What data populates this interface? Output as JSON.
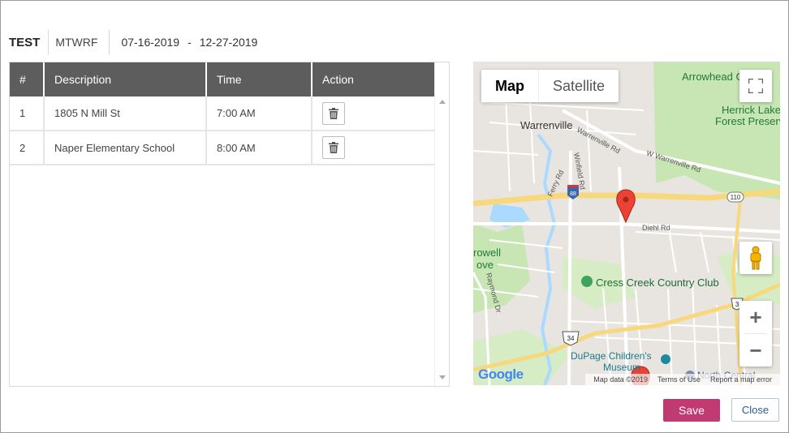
{
  "header": {
    "route_name": "TEST",
    "days": "MTWRF",
    "start_date": "07-16-2019",
    "date_separator": "-",
    "end_date": "12-27-2019"
  },
  "table": {
    "columns": [
      "#",
      "Description",
      "Time",
      "Action"
    ],
    "rows": [
      {
        "num": "1",
        "description": "1805 N Mill St",
        "time": "7:00 AM",
        "action_icon": "trash-icon"
      },
      {
        "num": "2",
        "description": "Naper Elementary School",
        "time": "8:00 AM",
        "action_icon": "trash-icon"
      }
    ]
  },
  "map": {
    "type_buttons": {
      "map": "Map",
      "satellite": "Satellite"
    },
    "selected_type": "Map",
    "labels": {
      "warrenville": "Warrenville",
      "arrowhead": "Arrowhead G",
      "herrick": "Herrick Lake",
      "forest": "Forest Preserv",
      "w_warrenville_rd": "W Warrenville Rd",
      "warrenville_rd": "Warrenville Rd",
      "diehl_rd": "Diehl Rd",
      "ferry_rd": "Ferry Rd",
      "winfield_rd": "Winfield Rd",
      "cress_creek": "Cress Creek Country Club",
      "dupage_childrens": "DuPage Children's",
      "museum": "Museum",
      "north_central": "North Central",
      "rowell": "rowell",
      "ove": "ove",
      "raymond_dr": "Raymond Dr",
      "shield_88": "88",
      "shield_110": "110",
      "shield_34": "34",
      "shield_3": "3"
    },
    "google_logo": "Google",
    "footer": {
      "map_data": "Map data ©2019",
      "terms": "Terms of Use",
      "report": "Report a map error"
    },
    "zoom_in": "+",
    "zoom_out": "−",
    "colors": {
      "water": "#aadaff",
      "park": "#c8e6b4",
      "highway": "#f7d87c",
      "road": "#ffffff",
      "marker": "#ea4335"
    }
  },
  "buttons": {
    "save": "Save",
    "close": "Close"
  },
  "colors": {
    "header_bg": "#5d5d5d",
    "save_bg": "#c03b71",
    "close_text": "#2a5b8c"
  }
}
